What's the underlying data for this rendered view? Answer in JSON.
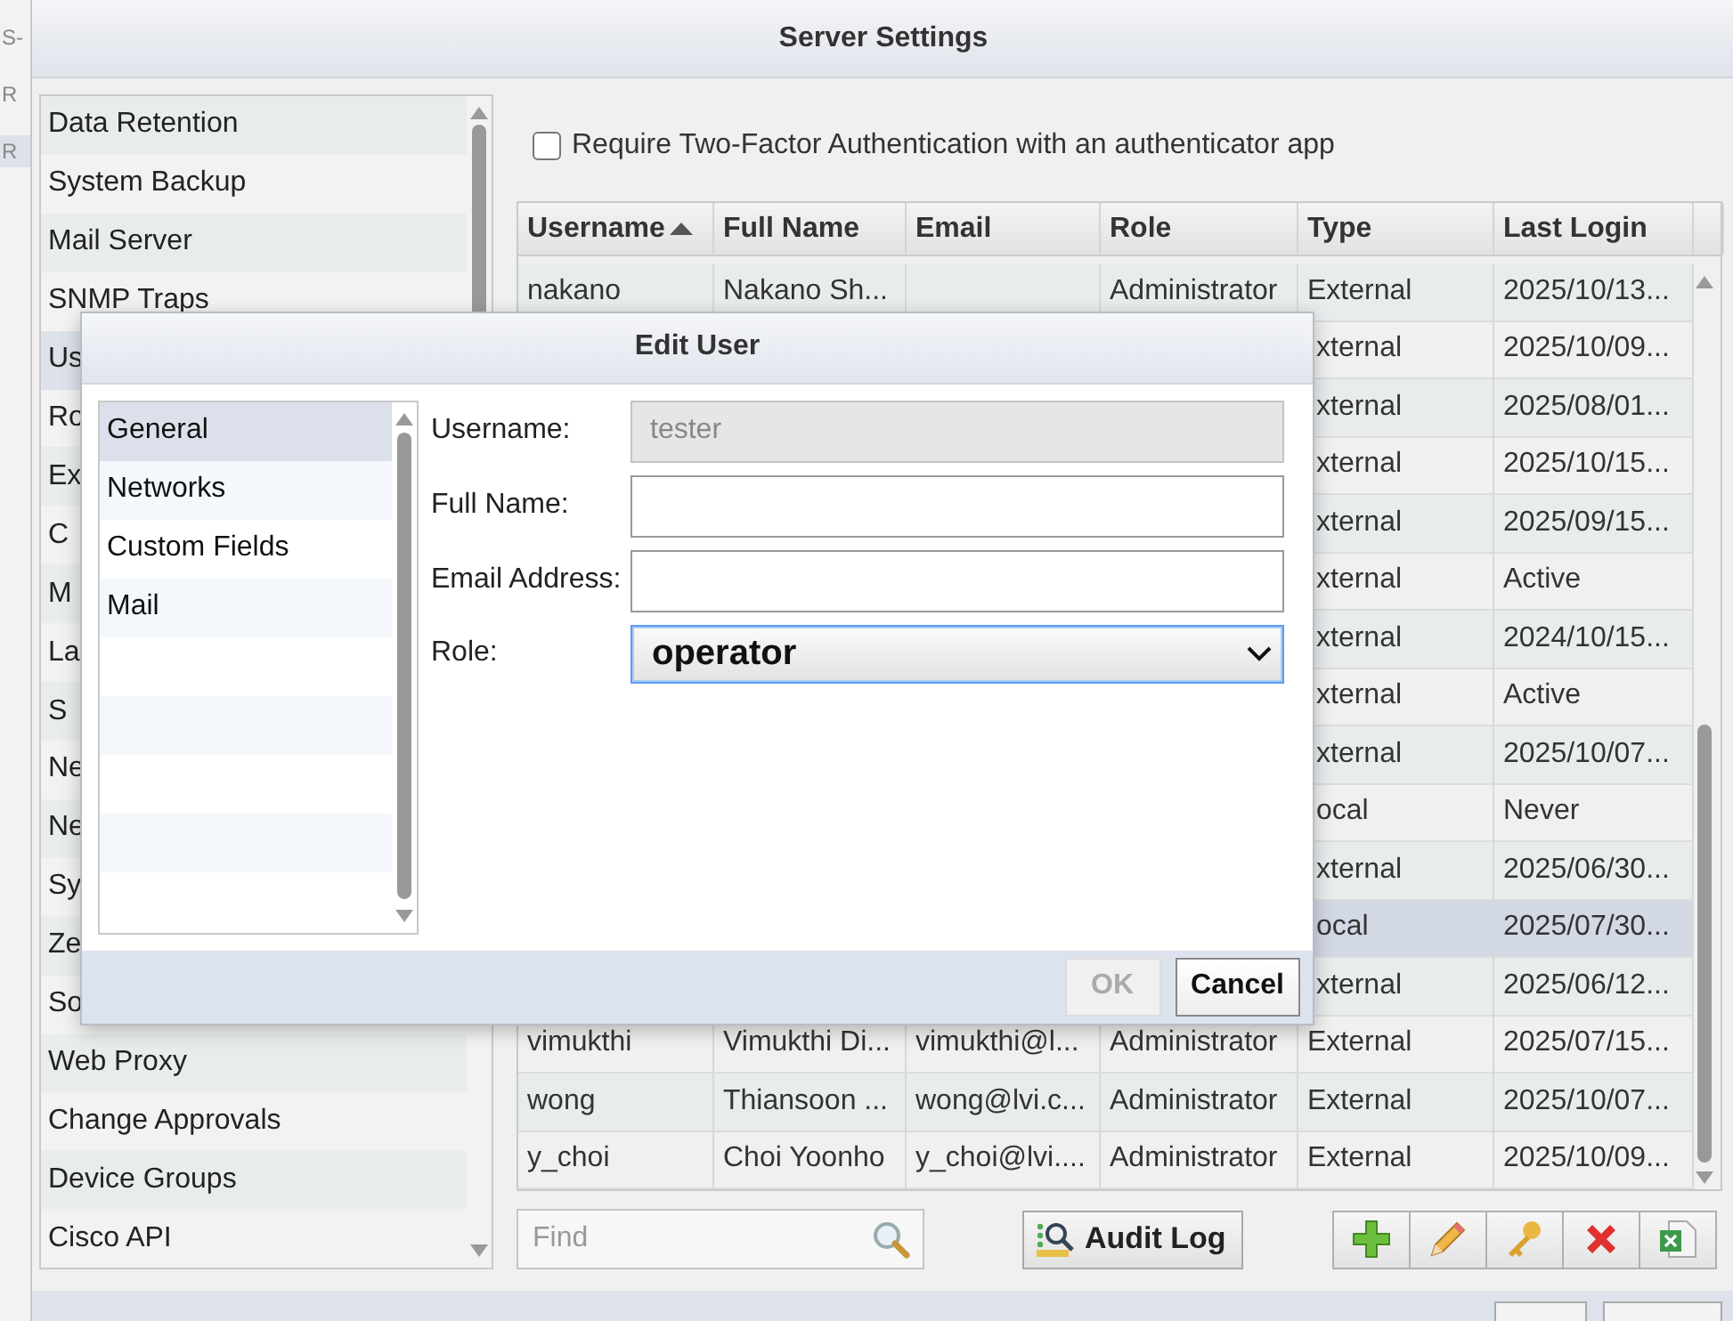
{
  "background_window": {
    "fragments": [
      "S-",
      "R",
      "R"
    ]
  },
  "window": {
    "title": "Server Settings"
  },
  "sidebar": {
    "items": [
      {
        "label": "Data Retention",
        "selected": false
      },
      {
        "label": "System Backup",
        "selected": false
      },
      {
        "label": "Mail Server",
        "selected": false
      },
      {
        "label": "SNMP Traps",
        "selected": false
      },
      {
        "label": "Us",
        "selected": true
      },
      {
        "label": "Ro",
        "selected": false
      },
      {
        "label": "Ex",
        "selected": false
      },
      {
        "label": "C",
        "selected": false
      },
      {
        "label": "M",
        "selected": false
      },
      {
        "label": "La",
        "selected": false
      },
      {
        "label": "S",
        "selected": false
      },
      {
        "label": "Ne",
        "selected": false
      },
      {
        "label": "Ne",
        "selected": false
      },
      {
        "label": "Sy",
        "selected": false
      },
      {
        "label": "Ze",
        "selected": false
      },
      {
        "label": "So",
        "selected": false
      },
      {
        "label": "Web Proxy",
        "selected": false
      },
      {
        "label": "Change Approvals",
        "selected": false
      },
      {
        "label": "Device Groups",
        "selected": false
      },
      {
        "label": "Cisco API",
        "selected": false
      }
    ]
  },
  "two_factor": {
    "label": "Require Two-Factor Authentication with an authenticator app",
    "checked": false
  },
  "table": {
    "columns": [
      "Username",
      "Full Name",
      "Email",
      "Role",
      "Type",
      "Last Login"
    ],
    "rows": [
      {
        "username": "nakano",
        "full_name": "Nakano Sh...",
        "role": "Administrator",
        "type": "External",
        "last_login": "2025/10/13...",
        "selected": false
      },
      {
        "type": "xternal",
        "last_login": "2025/10/09...",
        "selected": false
      },
      {
        "type": "xternal",
        "last_login": "2025/08/01...",
        "selected": false
      },
      {
        "type": "xternal",
        "last_login": "2025/10/15...",
        "selected": false
      },
      {
        "type": "xternal",
        "last_login": "2025/09/15...",
        "selected": false
      },
      {
        "type": "xternal",
        "last_login": "Active",
        "selected": false
      },
      {
        "type": "xternal",
        "last_login": "2024/10/15...",
        "selected": false
      },
      {
        "type": "xternal",
        "last_login": "Active",
        "selected": false
      },
      {
        "type": "xternal",
        "last_login": "2025/10/07...",
        "selected": false
      },
      {
        "type": "ocal",
        "last_login": "Never",
        "selected": false
      },
      {
        "type": "xternal",
        "last_login": "2025/06/30...",
        "selected": false
      },
      {
        "type": "ocal",
        "last_login": "2025/07/30...",
        "selected": true
      },
      {
        "type": "xternal",
        "last_login": "2025/06/12...",
        "selected": false
      },
      {
        "username": "vimukthi",
        "full_name": "Vimukthi Di...",
        "email": "vimukthi@l...",
        "role": "Administrator",
        "type": "External",
        "last_login": "2025/07/15...",
        "selected": false
      },
      {
        "username": "wong",
        "full_name": "Thiansoon ...",
        "email": "wong@lvi.c...",
        "role": "Administrator",
        "type": "External",
        "last_login": "2025/10/07...",
        "selected": false
      },
      {
        "username": "y_choi",
        "full_name": "Choi Yoonho",
        "email": "y_choi@lvi....",
        "role": "Administrator",
        "type": "External",
        "last_login": "2025/10/09...",
        "selected": false
      }
    ]
  },
  "find": {
    "placeholder": "Find"
  },
  "audit_log_button": "Audit Log",
  "dialog": {
    "title": "Edit User",
    "nav": [
      {
        "label": "General",
        "selected": true
      },
      {
        "label": "Networks",
        "selected": false
      },
      {
        "label": "Custom Fields",
        "selected": false
      },
      {
        "label": "Mail",
        "selected": false
      }
    ],
    "fields": [
      {
        "kind": "text",
        "label": "Username:",
        "value": "tester",
        "disabled": true
      },
      {
        "kind": "text",
        "label": "Full Name:",
        "disabled": false
      },
      {
        "kind": "text",
        "label": "Email Address:",
        "disabled": false
      },
      {
        "kind": "select",
        "label": "Role:",
        "value": "operator",
        "disabled": false
      }
    ],
    "buttons": [
      {
        "label": "OK",
        "disabled": true
      },
      {
        "label": "Cancel",
        "disabled": false
      }
    ]
  }
}
